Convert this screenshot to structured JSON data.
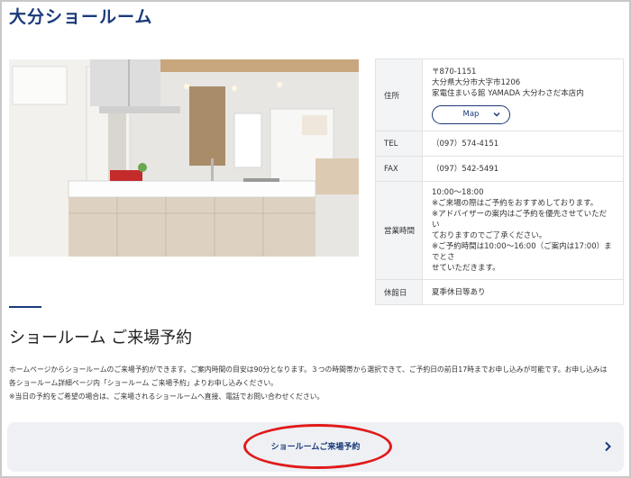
{
  "page": {
    "title": "大分ショールーム"
  },
  "info": {
    "address_label": "住所",
    "postal": "〒870-1151",
    "address_line1": "大分県大分市大字市1206",
    "address_line2": "家電住まいる館 YAMADA 大分わさだ本店内",
    "map_button": "Map",
    "tel_label": "TEL",
    "tel_value": "（097）574-4151",
    "fax_label": "FAX",
    "fax_value": "（097）542-5491",
    "hours_label": "営業時間",
    "hours_lines": [
      "10:00～18:00",
      "※ご来場の際はご予約をおすすめしております。",
      "※アドバイザーの案内はご予約を優先させていただい",
      "ておりますのでご了承ください。",
      "※ご予約時間は10:00～16:00（ご案内は17:00）までとさ",
      "せていただきます。"
    ],
    "closed_label": "休館日",
    "closed_value": "夏季休日等あり"
  },
  "reservation": {
    "title": "ショールーム ご来場予約",
    "desc_lines": [
      "ホームページからショールームのご来場予約ができます。ご案内時間の目安は90分となります。３つの時間帯から選択できて、ご予約日の前日17時までお申し込みが可能です。お申し込みは",
      "各ショールーム詳細ページ内「ショールーム ご来場予約」よりお申し込みください。",
      "※当日の予約をご希望の場合は、ご来場されるショールームへ直接、電話でお問い合わせください。"
    ],
    "button_label": "ショールームご来場予約"
  },
  "colors": {
    "navy": "#1a3a7a",
    "highlight": "#e01a1a",
    "button_bg": "#eef0f4"
  },
  "icons": {
    "map_chevron": "chevron-down-icon",
    "button_arrow": "chevron-right-icon"
  }
}
